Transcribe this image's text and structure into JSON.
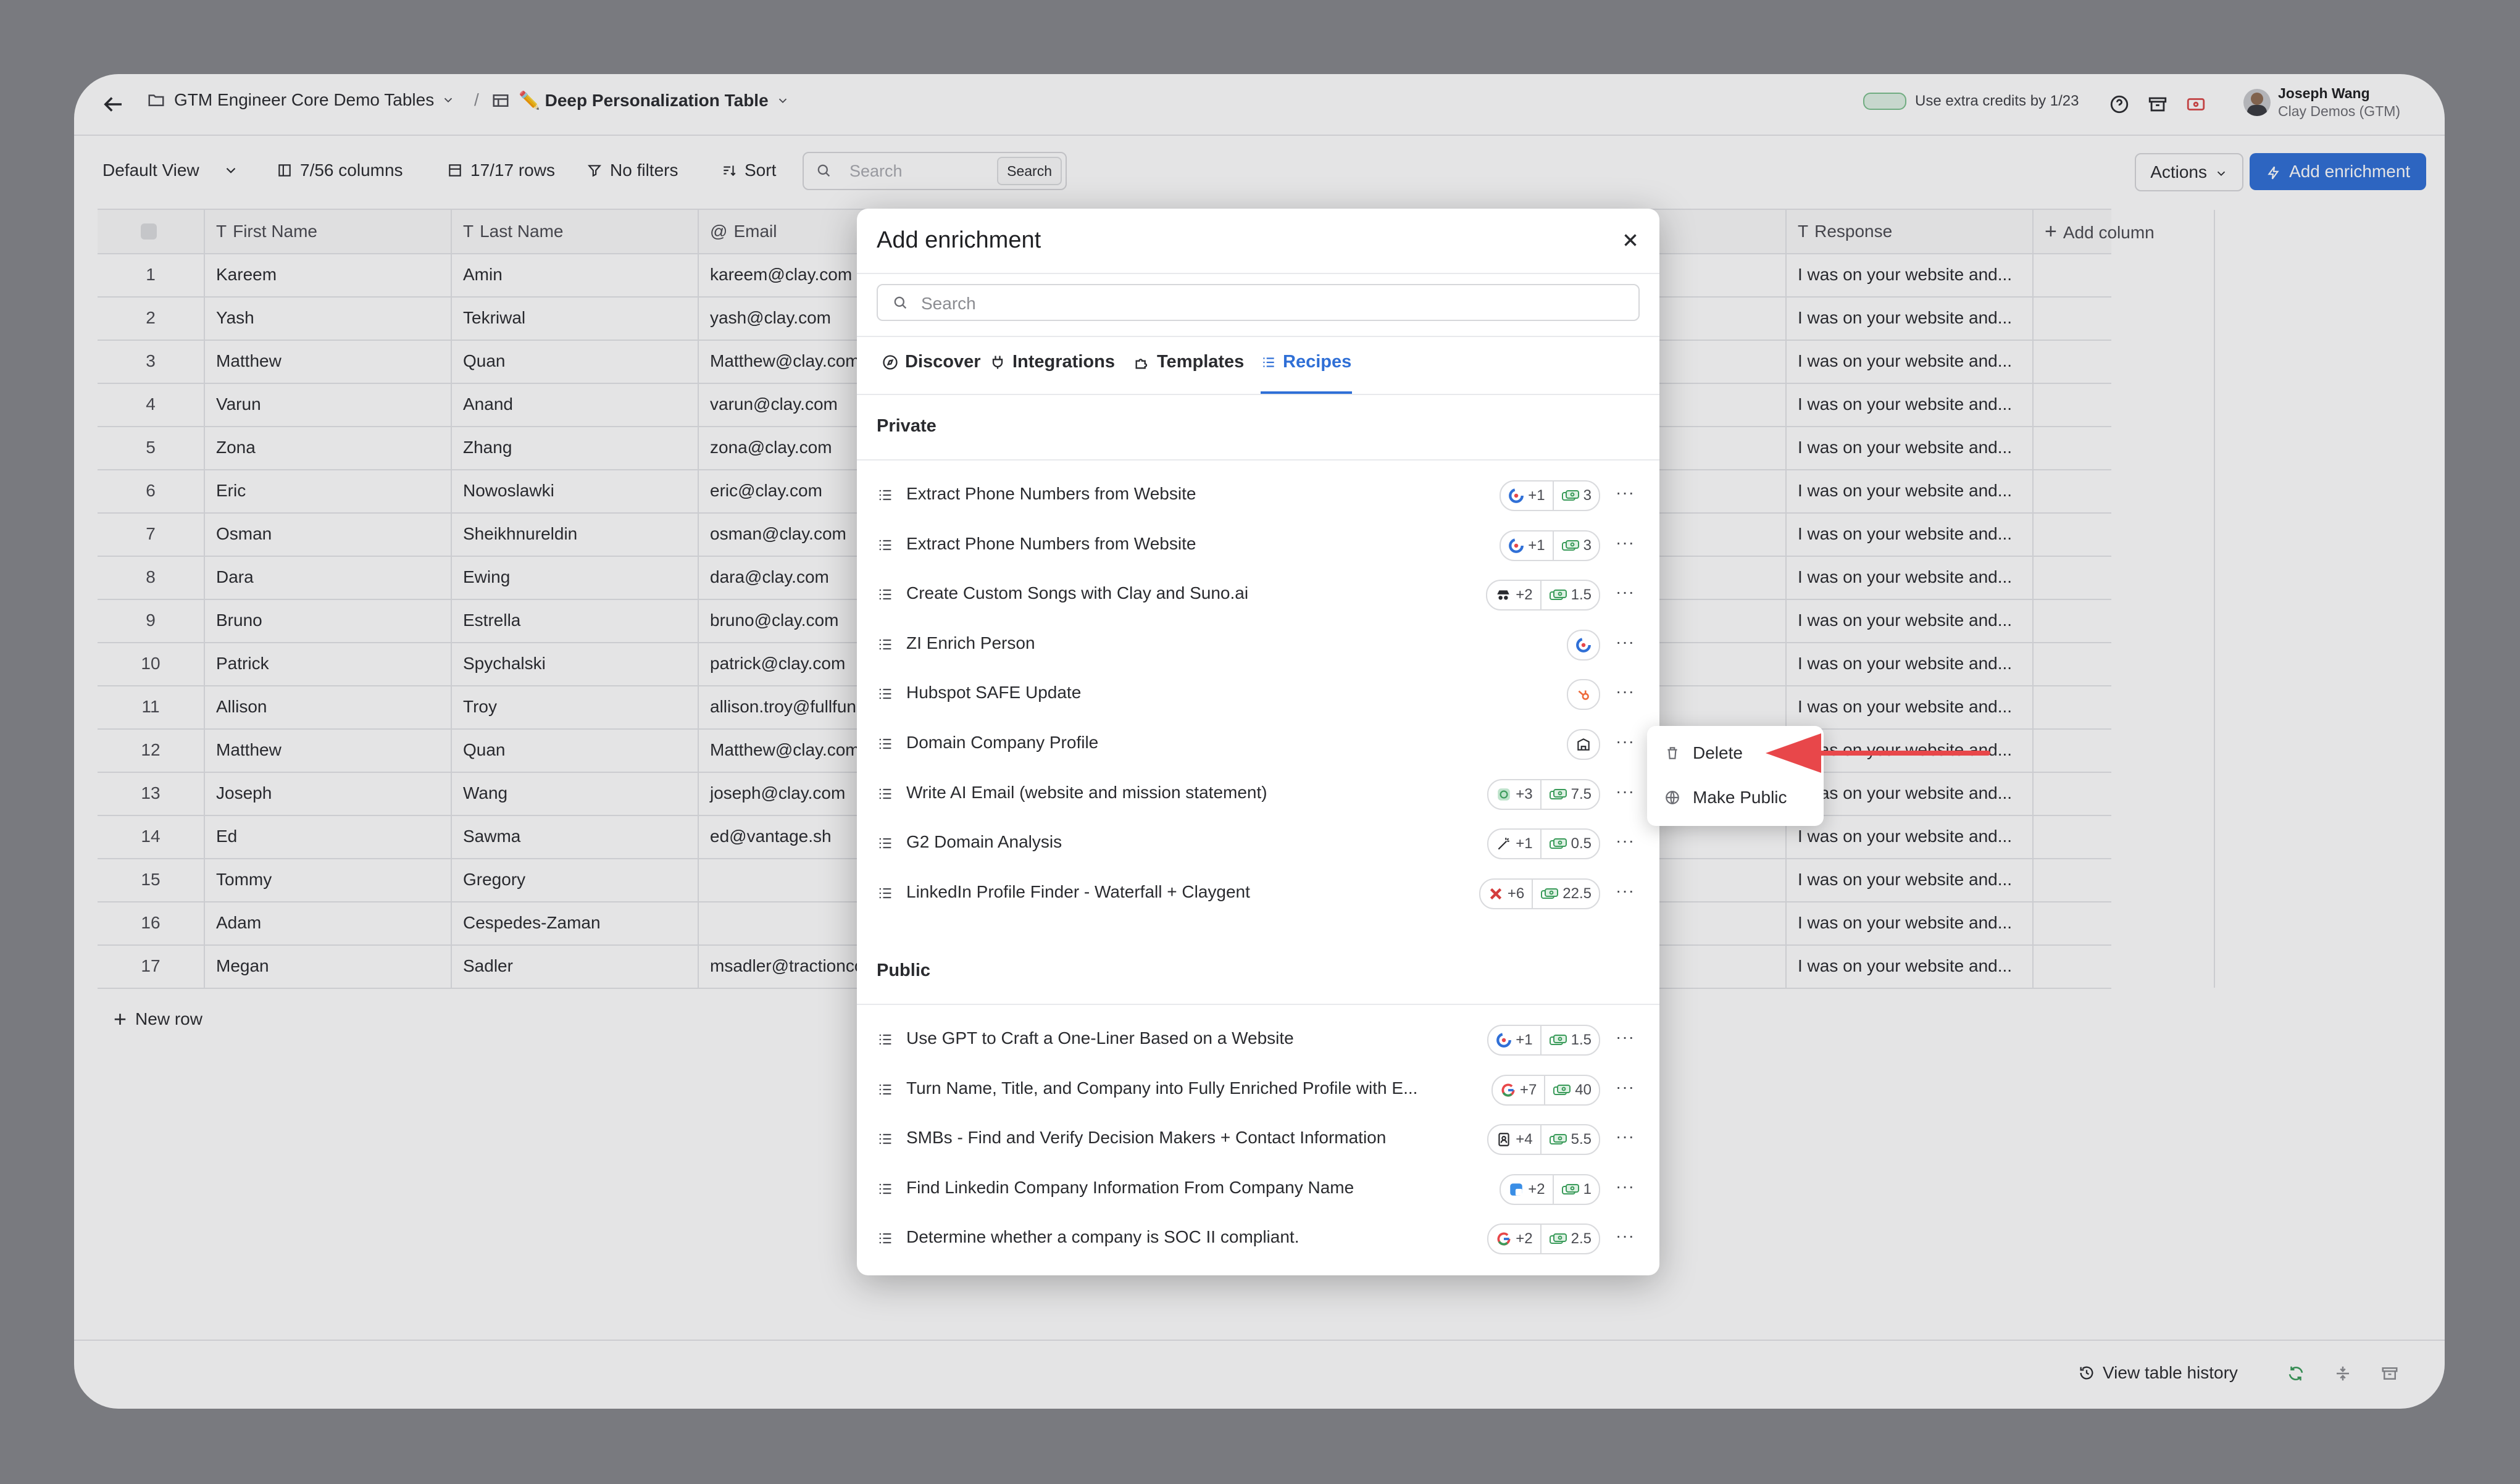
{
  "topbar": {
    "workspace": "GTM Engineer Core Demo Tables",
    "separator": "/",
    "table_name": "✏️ Deep Personalization Table",
    "credits_text": "Use extra credits by 1/23",
    "user_name": "Joseph Wang",
    "user_org": "Clay Demos (GTM)"
  },
  "toolbar": {
    "view": "Default View",
    "columns": "7/56 columns",
    "rows": "17/17 rows",
    "filters": "No filters",
    "sort": "Sort",
    "search_placeholder": "Search",
    "search_button": "Search",
    "actions": "Actions",
    "add_enrichment": "Add enrichment"
  },
  "table": {
    "headers": [
      "First Name",
      "Last Name",
      "Email",
      "Response",
      "Add column"
    ],
    "rows": [
      {
        "n": "1",
        "first": "Kareem",
        "last": "Amin",
        "email": "kareem@clay.com",
        "response": "I was on your website and..."
      },
      {
        "n": "2",
        "first": "Yash",
        "last": "Tekriwal",
        "email": "yash@clay.com",
        "response": "I was on your website and..."
      },
      {
        "n": "3",
        "first": "Matthew",
        "last": "Quan",
        "email": "Matthew@clay.com",
        "response": "I was on your website and..."
      },
      {
        "n": "4",
        "first": "Varun",
        "last": "Anand",
        "email": "varun@clay.com",
        "response": "I was on your website and..."
      },
      {
        "n": "5",
        "first": "Zona",
        "last": "Zhang",
        "email": "zona@clay.com",
        "response": "I was on your website and..."
      },
      {
        "n": "6",
        "first": "Eric",
        "last": "Nowoslawki",
        "email": "eric@clay.com",
        "response": "I was on your website and..."
      },
      {
        "n": "7",
        "first": "Osman",
        "last": "Sheikhnureldin",
        "email": "osman@clay.com",
        "response": "I was on your website and..."
      },
      {
        "n": "8",
        "first": "Dara",
        "last": "Ewing",
        "email": "dara@clay.com",
        "response": "I was on your website and..."
      },
      {
        "n": "9",
        "first": "Bruno",
        "last": "Estrella",
        "email": "bruno@clay.com",
        "response": "I was on your website and..."
      },
      {
        "n": "10",
        "first": "Patrick",
        "last": "Spychalski",
        "email": "patrick@clay.com",
        "response": "I was on your website and..."
      },
      {
        "n": "11",
        "first": "Allison",
        "last": "Troy",
        "email": "allison.troy@fullfunnel",
        "response": "I was on your website and..."
      },
      {
        "n": "12",
        "first": "Matthew",
        "last": "Quan",
        "email": "Matthew@clay.com",
        "response": "I was on your website and..."
      },
      {
        "n": "13",
        "first": "Joseph",
        "last": "Wang",
        "email": "joseph@clay.com",
        "response": "I was on your website and..."
      },
      {
        "n": "14",
        "first": "Ed",
        "last": "Sawma",
        "email": "ed@vantage.sh",
        "response": "I was on your website and..."
      },
      {
        "n": "15",
        "first": "Tommy",
        "last": "Gregory",
        "email": "",
        "response": "I was on your website and..."
      },
      {
        "n": "16",
        "first": "Adam",
        "last": "Cespedes-Zaman",
        "email": "",
        "response": "I was on your website and..."
      },
      {
        "n": "17",
        "first": "Megan",
        "last": "Sadler",
        "email": "msadler@tractioncomplete",
        "response": "I was on your website and..."
      }
    ],
    "new_row": "New row"
  },
  "footer": {
    "history": "View table history"
  },
  "modal": {
    "title": "Add enrichment",
    "search_placeholder": "Search",
    "tabs": [
      "Discover",
      "Integrations",
      "Templates",
      "Recipes"
    ],
    "active_tab": "Recipes",
    "private_label": "Private",
    "public_label": "Public",
    "private": [
      {
        "label": "Extract Phone Numbers from Website",
        "extra": "+1",
        "credits": "3",
        "icon": "clay-icon"
      },
      {
        "label": "Extract Phone Numbers from Website",
        "extra": "+1",
        "credits": "3",
        "icon": "clay-icon"
      },
      {
        "label": "Create Custom Songs with Clay and Suno.ai",
        "extra": "+2",
        "credits": "1.5",
        "icon": "spy-icon"
      },
      {
        "label": "ZI Enrich Person",
        "extra": "",
        "credits": "",
        "icon": "clay-icon"
      },
      {
        "label": "Hubspot SAFE Update",
        "extra": "",
        "credits": "",
        "icon": "hubspot-icon"
      },
      {
        "label": "Domain Company Profile",
        "extra": "",
        "credits": "",
        "icon": "building-icon"
      },
      {
        "label": "Write AI Email (website and mission statement)",
        "extra": "+3",
        "credits": "7.5",
        "icon": "ai-icon"
      },
      {
        "label": "G2 Domain Analysis",
        "extra": "+1",
        "credits": "0.5",
        "icon": "wand-icon"
      },
      {
        "label": "LinkedIn Profile Finder - Waterfall + Claygent",
        "extra": "+6",
        "credits": "22.5",
        "icon": "x-icon"
      }
    ],
    "public": [
      {
        "label": "Use GPT to Craft a One-Liner Based on a Website",
        "extra": "+1",
        "credits": "1.5",
        "icon": "clay-icon"
      },
      {
        "label": "Turn Name, Title, and Company into Fully Enriched Profile with E...",
        "extra": "+7",
        "credits": "40",
        "icon": "google-icon"
      },
      {
        "label": "SMBs - Find and Verify Decision Makers + Contact Information",
        "extra": "+4",
        "credits": "5.5",
        "icon": "contact-icon"
      },
      {
        "label": "Find Linkedin Company Information From Company Name",
        "extra": "+2",
        "credits": "1",
        "icon": "blue-square-icon"
      },
      {
        "label": "Determine whether a company is SOC II compliant.",
        "extra": "+2",
        "credits": "2.5",
        "icon": "google-icon"
      }
    ]
  },
  "context_menu": {
    "delete": "Delete",
    "make_public": "Make Public"
  },
  "colors": {
    "accent": "#2f6fd6",
    "arrow": "#e8474a",
    "backdrop": "#797a7f"
  }
}
